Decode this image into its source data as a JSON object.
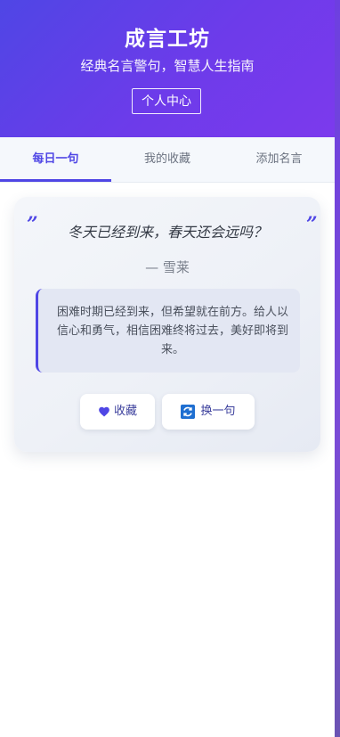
{
  "header": {
    "title": "成言工坊",
    "subtitle": "经典名言警句，智慧人生指南",
    "profile_button_label": "个人中心"
  },
  "tabs": [
    {
      "label": "每日一句",
      "active": true
    },
    {
      "label": "我的收藏",
      "active": false
    },
    {
      "label": "添加名言",
      "active": false
    }
  ],
  "quote": {
    "text": "冬天已经到来，春天还会远吗？",
    "author": "— 雪莱",
    "explanation": "困难时期已经到来，但希望就在前方。给人以信心和勇气，相信困难终将过去，美好即将到来。",
    "open_mark": "”",
    "close_mark": "”"
  },
  "actions": {
    "favorite_label": "收藏",
    "favorite_icon": "heart-icon",
    "next_label": "换一句",
    "next_icon": "refresh-icon"
  },
  "colors": {
    "accent": "#4f46e5",
    "header_gradient_start": "#4f46e5",
    "header_gradient_end": "#7c3aed"
  }
}
